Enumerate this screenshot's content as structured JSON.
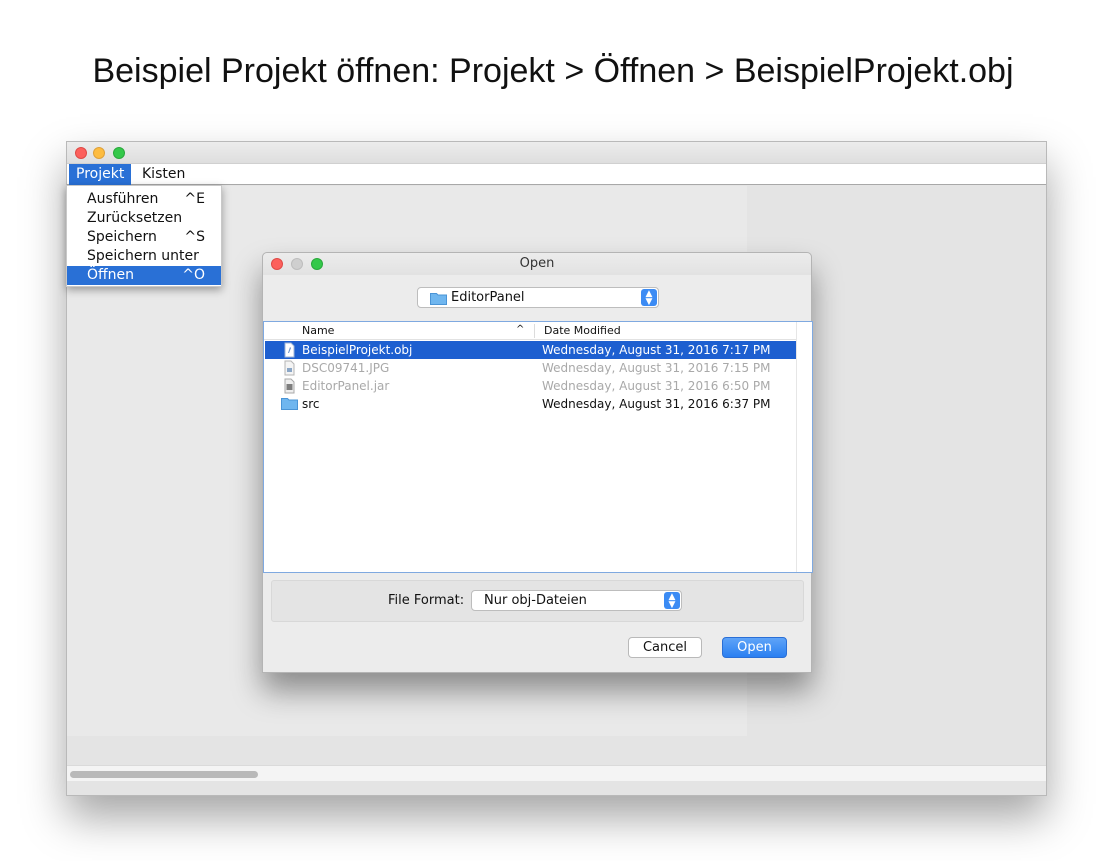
{
  "caption": "Beispiel Projekt öffnen: Projekt > Öffnen > BeispielProjekt.obj",
  "menubar": {
    "items": [
      {
        "label": "Projekt"
      },
      {
        "label": "Kisten"
      }
    ]
  },
  "dropdown": {
    "items": [
      {
        "label": "Ausführen",
        "shortcut": "^E"
      },
      {
        "label": "Zurücksetzen",
        "shortcut": ""
      },
      {
        "label": "Speichern",
        "shortcut": "^S"
      },
      {
        "label": "Speichern unter",
        "shortcut": ""
      },
      {
        "label": "Öffnen",
        "shortcut": "^O"
      }
    ]
  },
  "dialog": {
    "title": "Open",
    "folder": "EditorPanel",
    "columns": {
      "name": "Name",
      "date": "Date Modified"
    },
    "files": [
      {
        "name": "BeispielProjekt.obj",
        "date": "Wednesday, August 31, 2016 7:17 PM",
        "icon": "document-icon"
      },
      {
        "name": "DSC09741.JPG",
        "date": "Wednesday, August 31, 2016 7:15 PM",
        "icon": "image-file-icon"
      },
      {
        "name": "EditorPanel.jar",
        "date": "Wednesday, August 31, 2016 6:50 PM",
        "icon": "jar-file-icon"
      },
      {
        "name": "src",
        "date": "Wednesday, August 31, 2016 6:37 PM",
        "icon": "folder-icon"
      }
    ],
    "file_format_label": "File Format:",
    "file_format_value": "Nur obj-Dateien",
    "cancel_label": "Cancel",
    "open_label": "Open"
  },
  "colors": {
    "selection": "#1d5fd0",
    "menu_highlight": "#2970d6",
    "accent_button": "#2a7ff1"
  }
}
